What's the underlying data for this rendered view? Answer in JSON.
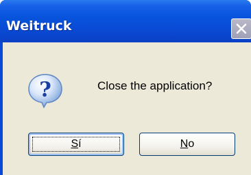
{
  "window": {
    "title": "Weitruck"
  },
  "dialog": {
    "icon": "question-icon",
    "message": "Close the application?",
    "buttons": {
      "yes": {
        "mnemonic": "S",
        "rest": "í",
        "label": "Sí"
      },
      "no": {
        "mnemonic": "N",
        "rest": "o",
        "label": "No"
      }
    }
  },
  "colors": {
    "titlebar": "#0a54e0",
    "body": "#ece9d8",
    "button_border": "#003c74"
  }
}
